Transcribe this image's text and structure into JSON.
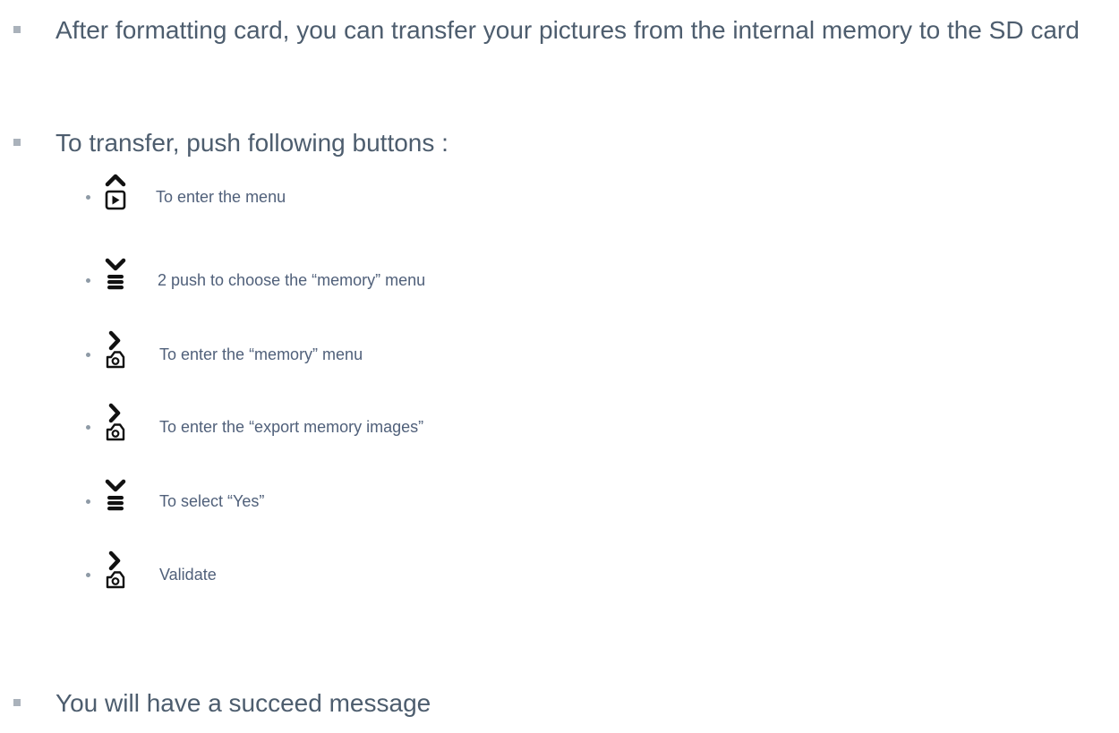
{
  "bullets": {
    "after_format": "After formatting card, you can transfer your pictures from the internal memory to the SD card",
    "to_transfer": "To transfer, push following buttons :",
    "succeed": "You will have a succeed message"
  },
  "steps": [
    {
      "icon": "up-play-button-icon",
      "label": "To enter the menu"
    },
    {
      "icon": "down-menu-button-icon",
      "label": "2 push to choose the “memory” menu"
    },
    {
      "icon": "right-camera-button-icon",
      "label": "To enter the “memory” menu"
    },
    {
      "icon": "right-camera-button-icon",
      "label": "To enter the “export memory images”"
    },
    {
      "icon": "down-menu-button-icon",
      "label": "To select “Yes”"
    },
    {
      "icon": "right-camera-button-icon",
      "label": "Validate"
    }
  ],
  "colors": {
    "text": "#4d5d6e",
    "bullet_marker": "#aab2bb",
    "icon": "#111111"
  }
}
